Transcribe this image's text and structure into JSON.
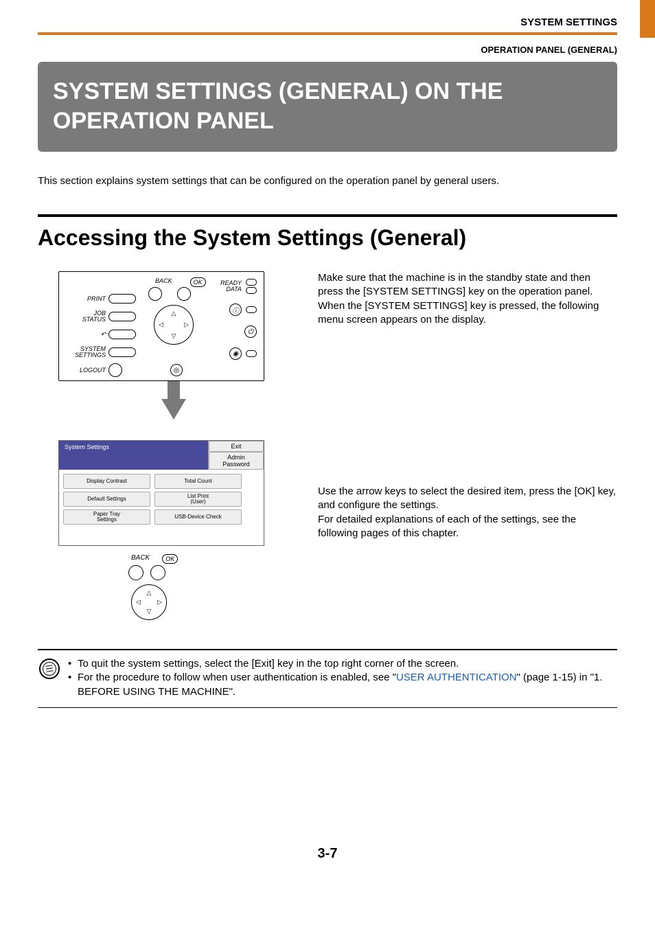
{
  "header": {
    "title": "SYSTEM SETTINGS",
    "subtitle": "OPERATION PANEL (GENERAL)"
  },
  "main": {
    "title_bar": "SYSTEM SETTINGS (GENERAL) ON THE OPERATION PANEL",
    "intro": "This section explains system settings that can be configured on the operation panel by general users.",
    "h2": "Accessing the System Settings (General)",
    "para1": "Make sure that the machine is in the standby state and then press the [SYSTEM SETTINGS] key on the operation panel.\nWhen the [SYSTEM SETTINGS] key is pressed, the following menu screen appears on the display.",
    "para2": "Use the arrow keys to select the desired item, press the [OK] key, and configure the settings.\nFor detailed explanations of each of the settings, see the following pages of this chapter."
  },
  "device_panel": {
    "labels": {
      "print": "PRINT",
      "job_status": "JOB\nSTATUS",
      "system_settings": "SYSTEM\nSETTINGS",
      "logout": "LOGOUT",
      "back": "BACK",
      "ok": "OK",
      "ready": "READY",
      "data": "DATA"
    }
  },
  "lcd": {
    "title": "System Settings",
    "buttons": {
      "exit": "Exit",
      "admin_password": "Admin Password"
    },
    "items_left": [
      "Display Contrast",
      "Default Settings",
      "Paper Tray\nSettings"
    ],
    "items_right": [
      "Total Count",
      "List Print\n(User)",
      "USB-Device Check"
    ]
  },
  "nav_small": {
    "back": "BACK",
    "ok": "OK"
  },
  "notes": {
    "bullet1": "To quit the system settings, select the [Exit] key in the top right corner of the screen.",
    "bullet2_pre": "For the procedure to follow when user authentication is enabled, see \"",
    "bullet2_link": "USER AUTHENTICATION",
    "bullet2_post": "\" (page 1-15) in \"1. BEFORE USING THE MACHINE\"."
  },
  "page_number": "3-7"
}
